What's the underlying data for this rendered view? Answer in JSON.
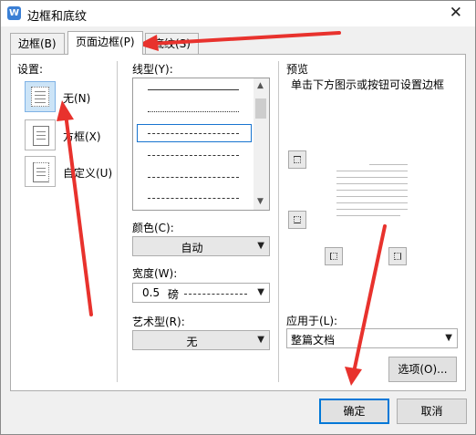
{
  "window": {
    "title": "边框和底纹",
    "app_icon": "wps-writer-icon",
    "close_glyph": "✕"
  },
  "tabs": [
    {
      "label": "边框(B)",
      "active": false
    },
    {
      "label": "页面边框(P)",
      "active": true
    },
    {
      "label": "底纹(S)",
      "active": false
    }
  ],
  "settings": {
    "heading": "设置:",
    "options": [
      {
        "label": "无(N)",
        "selected": true
      },
      {
        "label": "方框(X)",
        "selected": false
      },
      {
        "label": "自定义(U)",
        "selected": false
      }
    ]
  },
  "line_style": {
    "heading": "线型(Y):",
    "styles": [
      "solid",
      "dotted",
      "dashed-selected",
      "dashed",
      "dash-dot",
      "dash-dot-dot"
    ]
  },
  "color": {
    "heading": "颜色(C):",
    "value": "自动"
  },
  "width": {
    "heading": "宽度(W):",
    "value": "0.5",
    "unit": "磅"
  },
  "art": {
    "heading": "艺术型(R):",
    "value": "无"
  },
  "preview": {
    "heading": "预览",
    "hint": "单击下方图示或按钮可设置边框"
  },
  "apply_to": {
    "heading": "应用于(L):",
    "value": "整篇文档"
  },
  "buttons": {
    "options": "选项(O)...",
    "ok": "确定",
    "cancel": "取消"
  },
  "colors": {
    "annotation_arrow": "#e8322d",
    "selection_border": "#1874d0",
    "primary_button_border": "#0078d7"
  }
}
